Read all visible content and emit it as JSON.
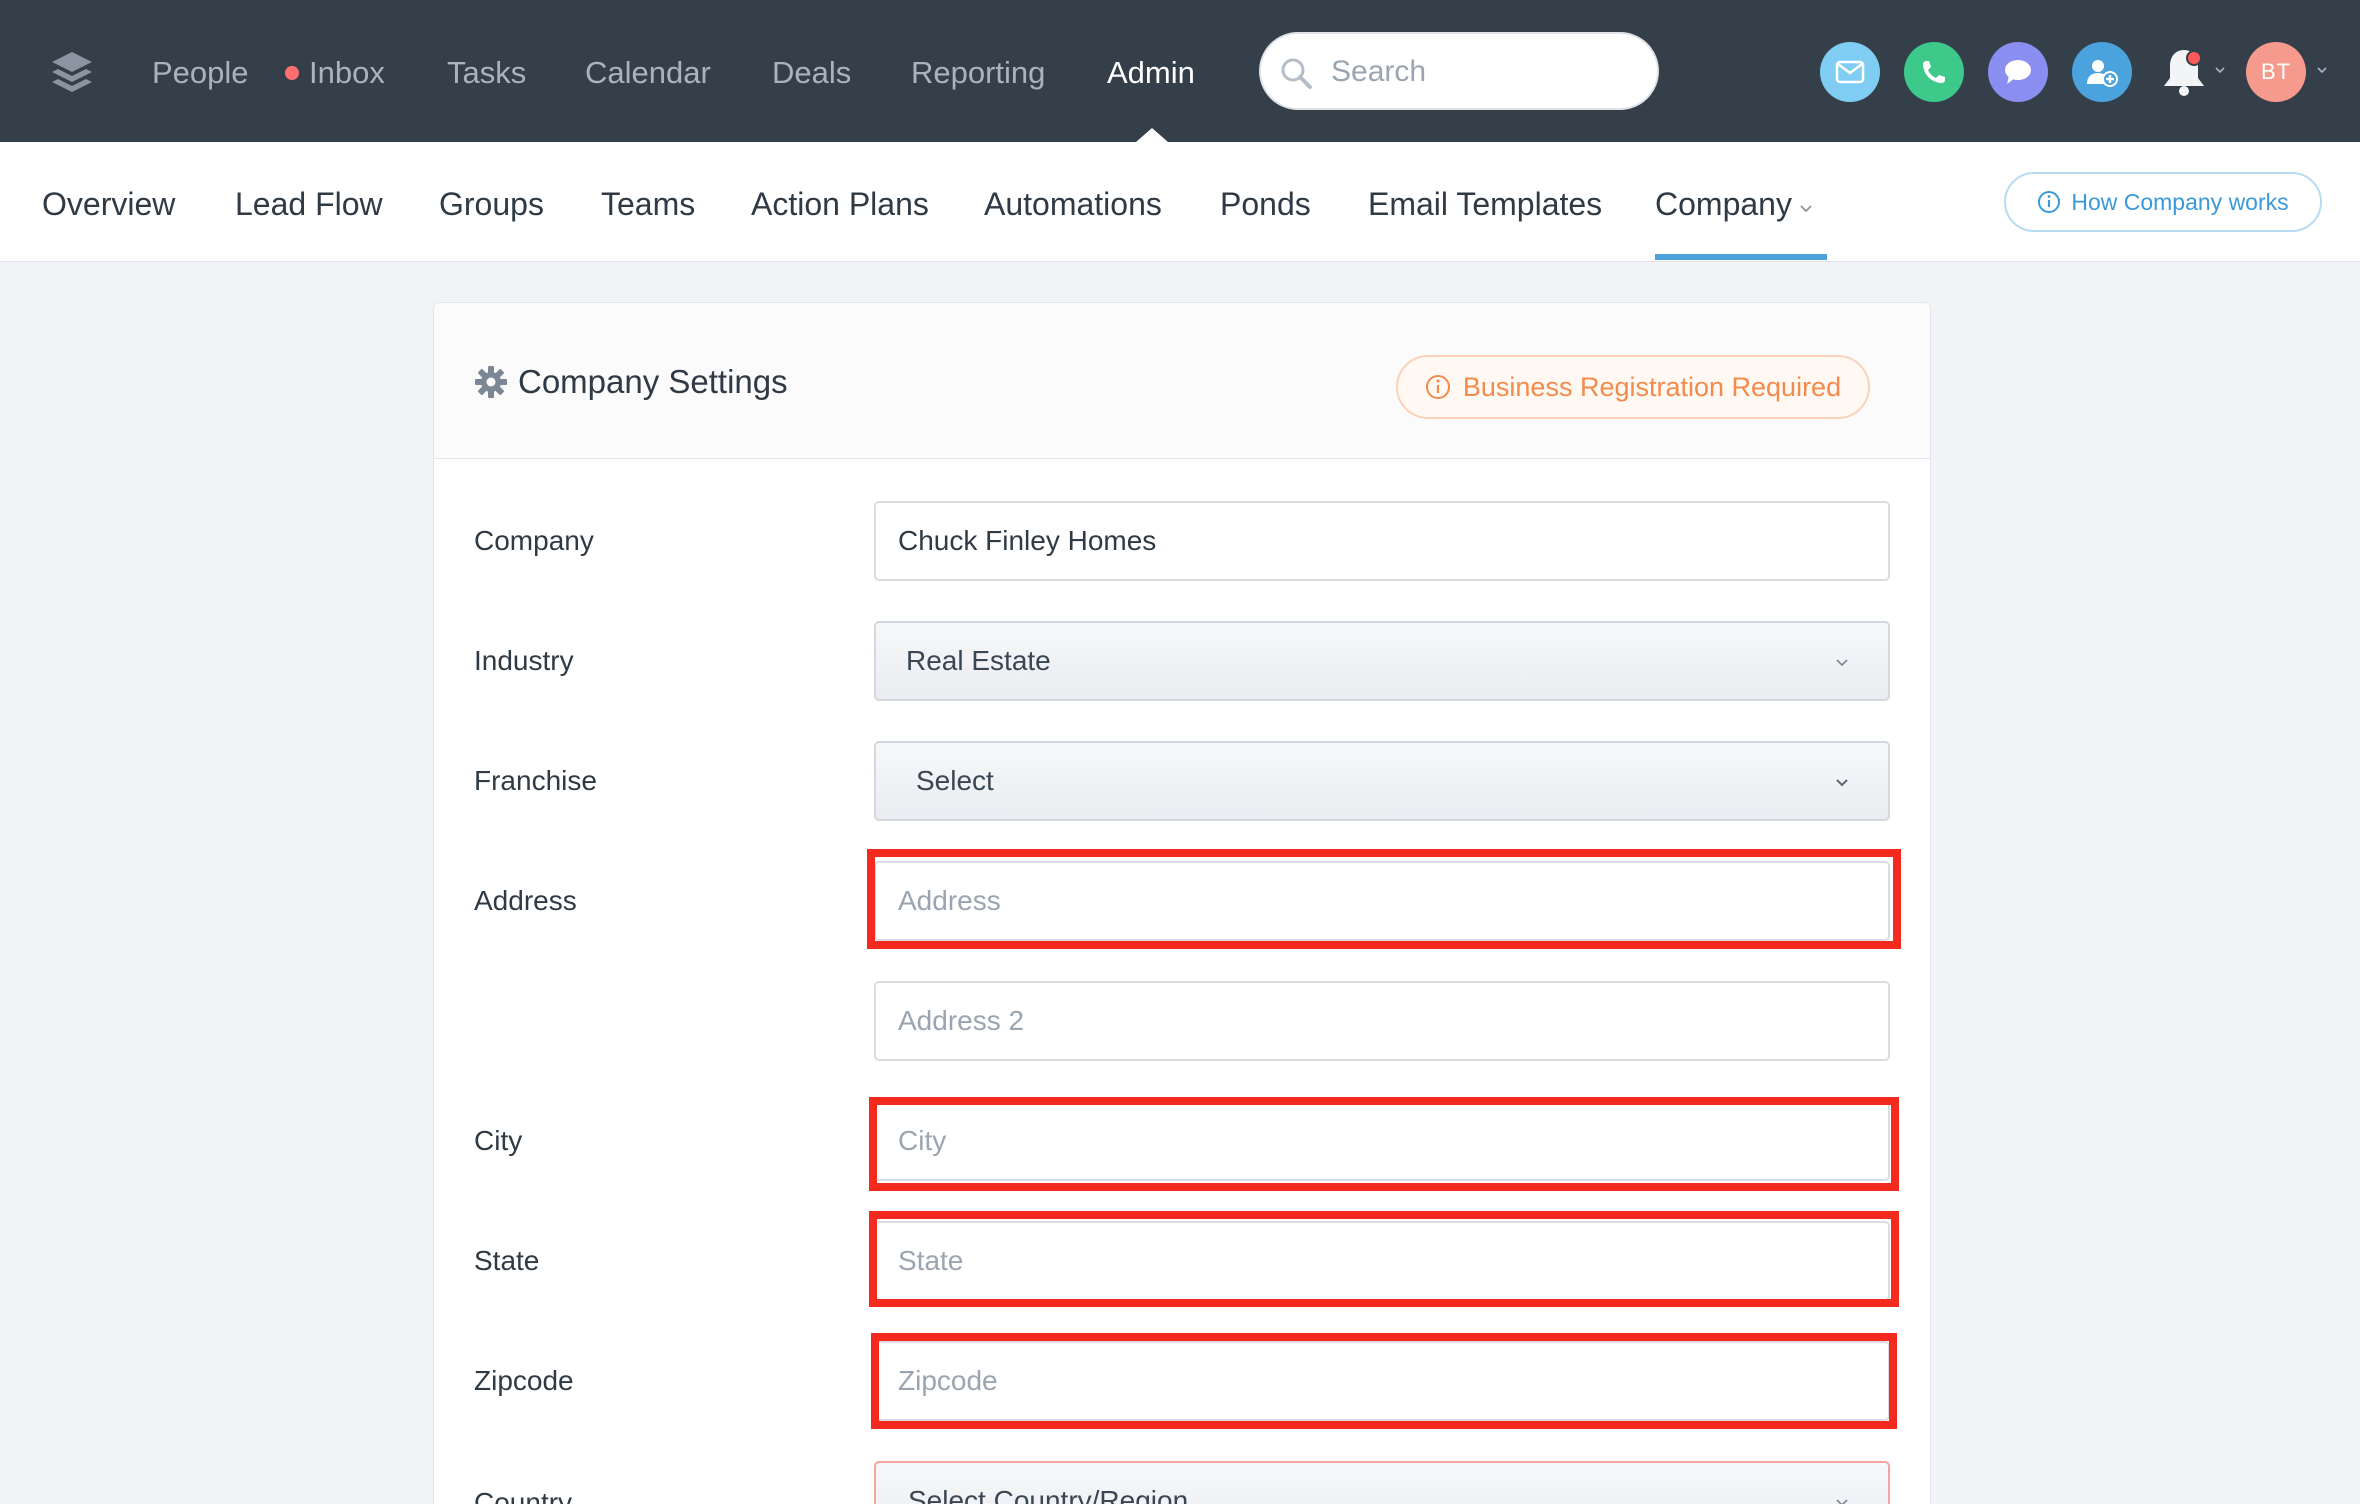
{
  "topnav": {
    "items": [
      "People",
      "Inbox",
      "Tasks",
      "Calendar",
      "Deals",
      "Reporting",
      "Admin"
    ],
    "active": "Admin",
    "search_placeholder": "Search",
    "avatar_initials": "BT"
  },
  "subnav": {
    "items": [
      "Overview",
      "Lead Flow",
      "Groups",
      "Teams",
      "Action Plans",
      "Automations",
      "Ponds",
      "Email Templates",
      "Company"
    ],
    "active": "Company",
    "help_label": "How Company works"
  },
  "card": {
    "title": "Company Settings",
    "badge": "Business Registration Required",
    "fields": {
      "company_label": "Company",
      "company_value": "Chuck Finley Homes",
      "industry_label": "Industry",
      "industry_value": "Real Estate",
      "franchise_label": "Franchise",
      "franchise_value": "Select",
      "address_label": "Address",
      "address_placeholder": "Address",
      "address2_placeholder": "Address 2",
      "city_label": "City",
      "city_placeholder": "City",
      "state_label": "State",
      "state_placeholder": "State",
      "zipcode_label": "Zipcode",
      "zipcode_placeholder": "Zipcode",
      "country_label": "Country",
      "country_value": "Select Country/Region"
    }
  },
  "colors": {
    "topbar": "#343f4a",
    "accent": "#4ba3d9",
    "highlight": "#f42a1e",
    "badge": "#f28b4b"
  },
  "icons": [
    "logo-icon",
    "search-icon",
    "email-icon",
    "phone-icon",
    "chat-icon",
    "add-contact-icon",
    "bell-icon",
    "gear-icon",
    "info-icon",
    "chevron-down-icon"
  ]
}
